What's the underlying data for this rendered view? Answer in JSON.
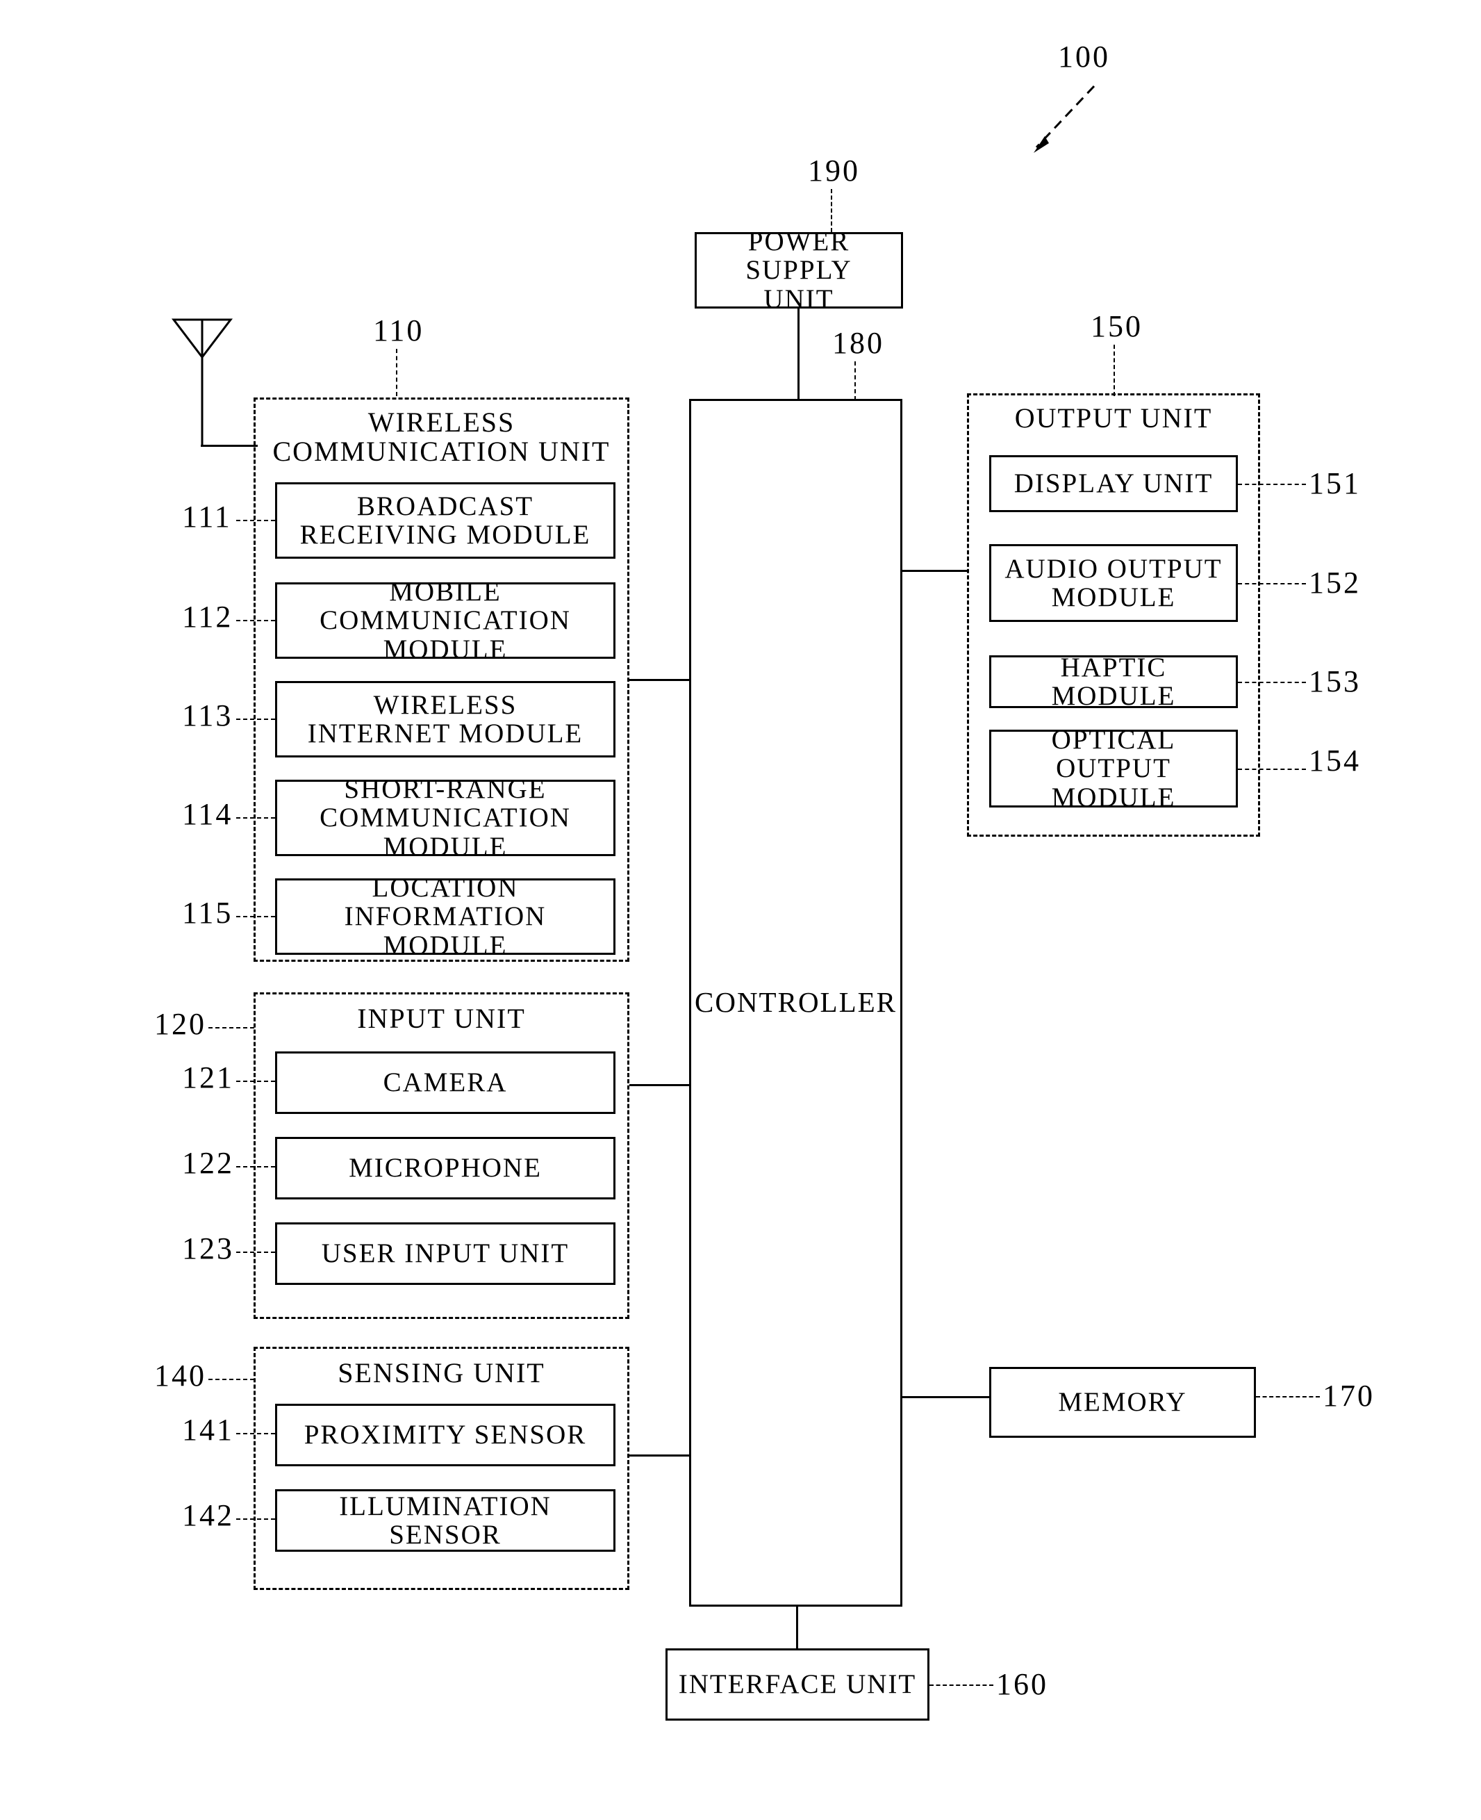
{
  "figure": {
    "device_ref": "100",
    "antenna_icon": "antenna-icon"
  },
  "power_supply": {
    "ref": "190",
    "label": "POWER SUPPLY\nUNIT"
  },
  "controller": {
    "ref": "180",
    "label": "CONTROLLER"
  },
  "wireless_communication_unit": {
    "ref": "110",
    "title": "WIRELESS\nCOMMUNICATION UNIT",
    "modules": [
      {
        "ref": "111",
        "label": "BROADCAST\nRECEIVING MODULE"
      },
      {
        "ref": "112",
        "label": "MOBILE\nCOMMUNICATION MODULE"
      },
      {
        "ref": "113",
        "label": "WIRELESS\nINTERNET MODULE"
      },
      {
        "ref": "114",
        "label": "SHORT-RANGE\nCOMMUNICATION MODULE"
      },
      {
        "ref": "115",
        "label": "LOCATION\nINFORMATION MODULE"
      }
    ]
  },
  "input_unit": {
    "ref": "120",
    "title": "INPUT UNIT",
    "modules": [
      {
        "ref": "121",
        "label": "CAMERA"
      },
      {
        "ref": "122",
        "label": "MICROPHONE"
      },
      {
        "ref": "123",
        "label": "USER INPUT UNIT"
      }
    ]
  },
  "sensing_unit": {
    "ref": "140",
    "title": "SENSING UNIT",
    "modules": [
      {
        "ref": "141",
        "label": "PROXIMITY SENSOR"
      },
      {
        "ref": "142",
        "label": "ILLUMINATION SENSOR"
      }
    ]
  },
  "output_unit": {
    "ref": "150",
    "title": "OUTPUT UNIT",
    "modules": [
      {
        "ref": "151",
        "label": "DISPLAY UNIT"
      },
      {
        "ref": "152",
        "label": "AUDIO OUTPUT\nMODULE"
      },
      {
        "ref": "153",
        "label": "HAPTIC MODULE"
      },
      {
        "ref": "154",
        "label": "OPTICAL OUTPUT\nMODULE"
      }
    ]
  },
  "memory": {
    "ref": "170",
    "label": "MEMORY"
  },
  "interface_unit": {
    "ref": "160",
    "label": "INTERFACE UNIT"
  }
}
